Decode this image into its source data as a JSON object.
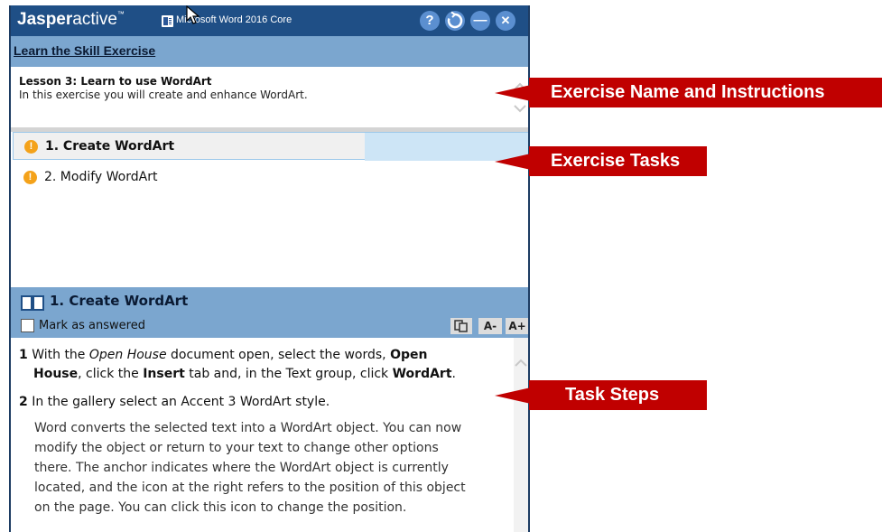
{
  "titlebar": {
    "brand_bold": "Jasper",
    "brand_light": "active",
    "brand_tm": "™",
    "product": "Microsoft Word 2016 Core",
    "help_label": "?",
    "minimize_label": "—",
    "close_label": "✕"
  },
  "exercise": {
    "section_title": "Learn the Skill Exercise",
    "lesson_title": "Lesson 3: Learn to use WordArt",
    "lesson_desc": "In this exercise you will create and enhance WordArt."
  },
  "tasks": [
    {
      "label": "1. Create WordArt",
      "selected": true,
      "icon": "warning-icon"
    },
    {
      "label": "2. Modify WordArt",
      "selected": false,
      "icon": "warning-icon"
    }
  ],
  "step_panel": {
    "title": "1. Create WordArt",
    "mark_answered": "Mark as answered",
    "font_decrease": "A-",
    "font_increase": "A+"
  },
  "steps": {
    "s1_num": "1",
    "s1_a": "With the ",
    "s1_b": "Open House",
    "s1_c": " document open, select the words, ",
    "s1_d": "Open",
    "s1_e": "House",
    "s1_f": ", click the ",
    "s1_g": "Insert",
    "s1_h": " tab and, in the Text group, click ",
    "s1_i": "WordArt",
    "s1_j": ".",
    "s2_num": "2",
    "s2_text": "In the gallery select an Accent 3 WordArt style.",
    "para_lines": [
      "Word converts the selected text into a WordArt object. You can now",
      "modify the object or return to your text to change other options",
      "there. The anchor indicates where the WordArt object is currently",
      "located, and the icon at the right refers to the position of this object",
      "on the page. You can click this icon to change the position."
    ]
  },
  "callouts": {
    "instructions": "Exercise Name and Instructions",
    "tasks": "Exercise Tasks",
    "steps": "Task Steps"
  },
  "colors": {
    "titlebar": "#1f4f86",
    "header": "#7ba6cf",
    "callout": "#c00000",
    "warning": "#f4a21a"
  }
}
